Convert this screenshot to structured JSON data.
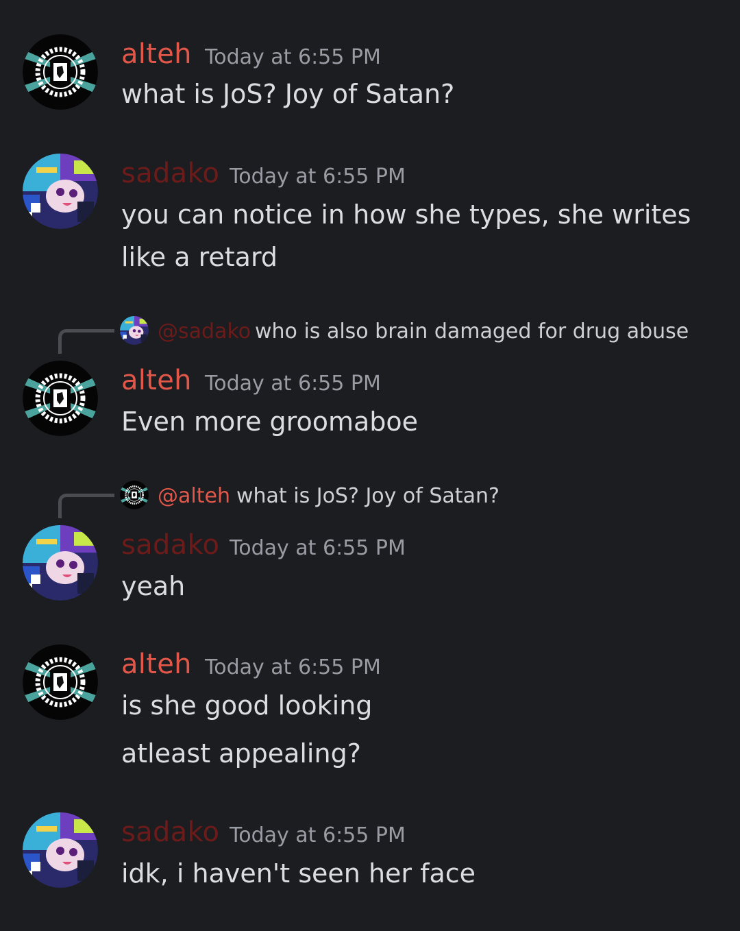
{
  "messages": [
    {
      "author": "alteh",
      "timestamp": "Today at 6:55 PM",
      "lines": [
        "what is JoS? Joy of Satan?"
      ]
    },
    {
      "author": "sadako",
      "timestamp": "Today at 6:55 PM",
      "lines": [
        "you can notice in how she types, she writes",
        "like a retard"
      ]
    },
    {
      "author": "alteh",
      "timestamp": "Today at 6:55 PM",
      "lines": [
        "Even more groomaboe"
      ],
      "reply": {
        "mention": "@sadako",
        "text": "who is also brain damaged for drug abuse"
      }
    },
    {
      "author": "sadako",
      "timestamp": "Today at 6:55 PM",
      "lines": [
        "yeah"
      ],
      "reply": {
        "mention": "@alteh",
        "text": "what is JoS? Joy of Satan?"
      }
    },
    {
      "author": "alteh",
      "timestamp": "Today at 6:55 PM",
      "lines": [
        "is she good looking",
        "atleast appealing?"
      ]
    },
    {
      "author": "sadako",
      "timestamp": "Today at 6:55 PM",
      "lines": [
        "idk, i haven't seen her face"
      ]
    }
  ],
  "colors": {
    "background": "#1c1d21",
    "alteh_name": "#e1584a",
    "sadako_name": "#6b1b1a",
    "timestamp": "#9a9ca3"
  },
  "icons": {
    "alteh_avatar": "laurel-emblem-avatar",
    "sadako_avatar": "anime-glitch-avatar"
  }
}
